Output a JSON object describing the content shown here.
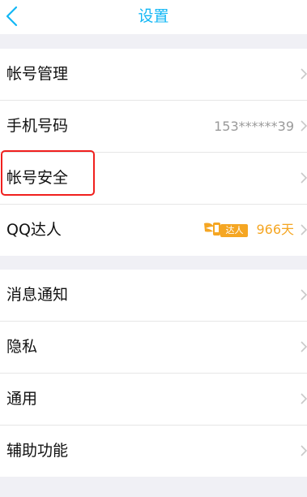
{
  "header": {
    "title": "设置"
  },
  "group1": [
    {
      "label": "帐号管理",
      "value": ""
    },
    {
      "label": "手机号码",
      "value": "153******39"
    },
    {
      "label": "帐号安全",
      "value": ""
    },
    {
      "label": "QQ达人",
      "badge_tag": "达人",
      "badge_days": "966天"
    }
  ],
  "group2": [
    {
      "label": "消息通知"
    },
    {
      "label": "隐私"
    },
    {
      "label": "通用"
    },
    {
      "label": "辅助功能"
    }
  ],
  "colors": {
    "accent": "#12b7f5",
    "highlight": "#f0201e",
    "badge": "#f5a623"
  }
}
